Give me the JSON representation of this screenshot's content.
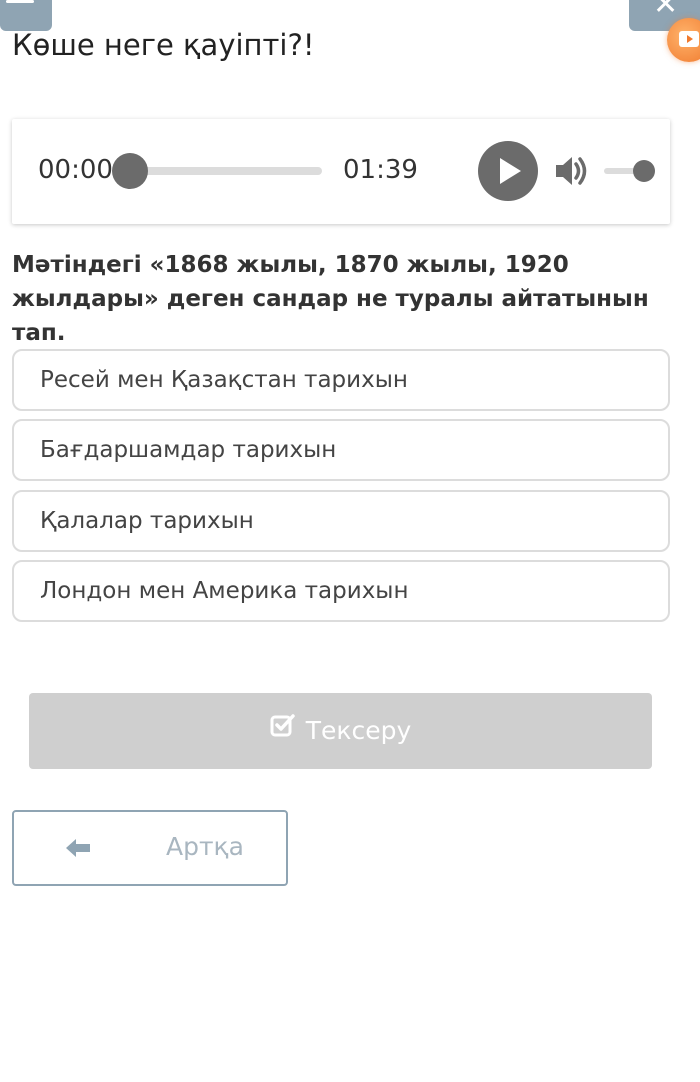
{
  "header": {
    "menu_icon": "hamburger-menu-icon",
    "close_icon": "close-icon",
    "badge_icon": "video-play-icon",
    "badge_color": "#f07a2e",
    "bar_color": "#8fa4b3"
  },
  "title": "Көше неге қауіпті?!",
  "audio": {
    "current_time": "00:00",
    "total_time": "01:39",
    "progress": 0,
    "volume": 0.85,
    "play_icon": "play-icon",
    "volume_icon": "volume-icon"
  },
  "question": "Мәтіндегі «1868 жылы, 1870 жылы, 1920 жылдары» деген сандар не туралы айтатынын тап.",
  "options": [
    "Ресей мен Қазақстан тарихын",
    "Бағдаршамдар тарихын",
    "Қалалар тарихын",
    "Лондон мен Америка тарихын"
  ],
  "check_button": {
    "label": "Тексеру",
    "icon": "checkbox-icon",
    "color": "#cfcfcf"
  },
  "back_button": {
    "label": "Артқа",
    "icon": "arrow-left-icon"
  }
}
